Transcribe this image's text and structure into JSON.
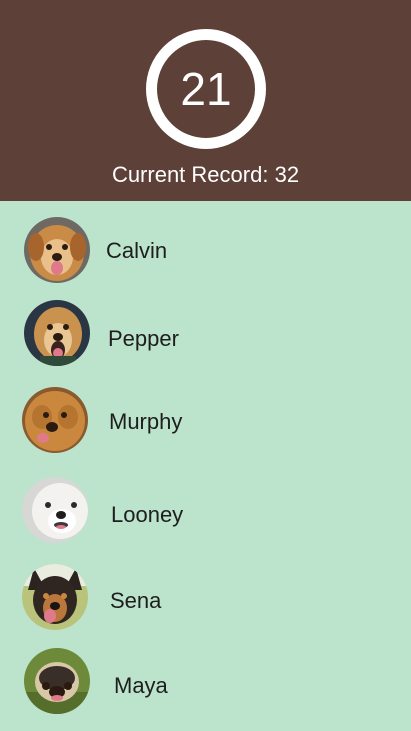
{
  "counter": {
    "value": "21"
  },
  "record": {
    "label": "Current Record:",
    "value": "32"
  },
  "colors": {
    "header": "#5D4037",
    "list_background": "#BCE3CC",
    "ring": "#FFFFFF"
  },
  "dogs": [
    {
      "name": "Calvin",
      "icon": "golden-retriever-photo"
    },
    {
      "name": "Pepper",
      "icon": "golden-retriever-photo"
    },
    {
      "name": "Murphy",
      "icon": "goldendoodle-photo"
    },
    {
      "name": "Looney",
      "icon": "white-dog-photo"
    },
    {
      "name": "Sena",
      "icon": "shepherd-dog-photo"
    },
    {
      "name": "Maya",
      "icon": "dog-on-grass-photo"
    }
  ]
}
